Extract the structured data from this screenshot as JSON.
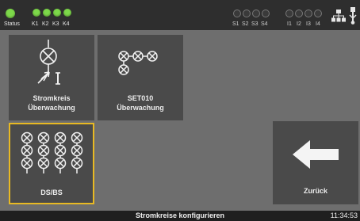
{
  "status_bar": {
    "status_label": "Status",
    "relay_labels": [
      "K1",
      "K2",
      "K3",
      "K4"
    ],
    "sensor_labels": [
      "S1",
      "S2",
      "S3",
      "S4"
    ],
    "input_labels": [
      "I1",
      "I2",
      "I3",
      "I4"
    ],
    "status_led": "on",
    "relay_leds": [
      "on",
      "on",
      "on",
      "on"
    ],
    "sensor_leds": [
      "off",
      "off",
      "off",
      "off"
    ],
    "input_leds": [
      "off",
      "off",
      "off",
      "off"
    ],
    "network_icon": "network-icon",
    "usb_icon": "usb-icon"
  },
  "tiles": {
    "stromkreis": {
      "line1": "Stromkreis",
      "line2": "Überwachung",
      "icon": "lamp-current-monitor-icon"
    },
    "set010": {
      "line1": "SET010",
      "line2": "Überwachung",
      "icon": "lamp-group-icon"
    },
    "dsbs": {
      "label": "DS/BS",
      "icon": "lamp-grid-icon",
      "selected": true
    },
    "zurueck": {
      "label": "Zurück",
      "icon": "arrow-left-icon"
    }
  },
  "footer": {
    "title": "Stromkreise konfigurieren",
    "time": "11:34:53"
  },
  "colors": {
    "led_on": "#7dd84a",
    "selection": "#e8b923",
    "tile": "#4a4a4a",
    "background": "#6e6e6e"
  }
}
